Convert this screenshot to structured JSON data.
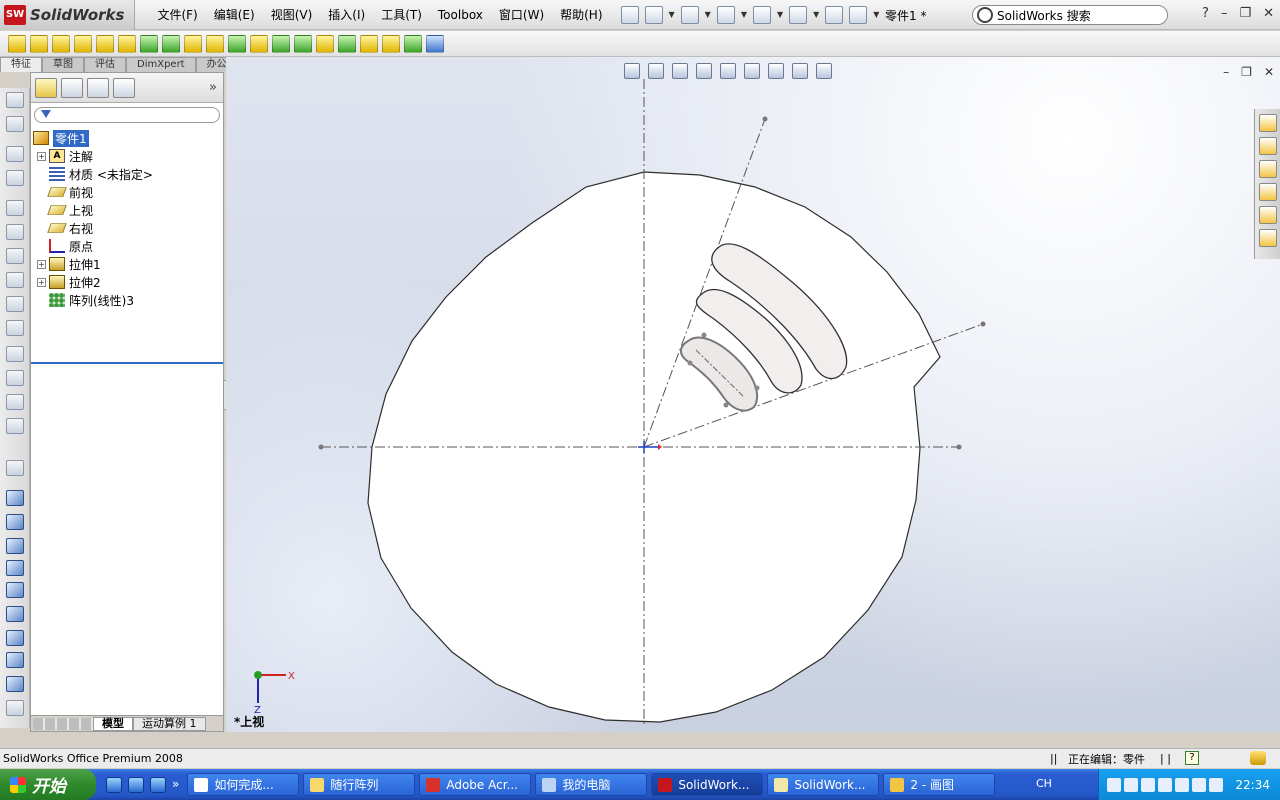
{
  "app": {
    "logo_text": "SolidWorks",
    "document_title": "零件1 *",
    "search_placeholder": "SolidWorks 搜索"
  },
  "menu": [
    "文件(F)",
    "编辑(E)",
    "视图(V)",
    "插入(I)",
    "工具(T)",
    "Toolbox",
    "窗口(W)",
    "帮助(H)"
  ],
  "command_tabs": [
    "特征",
    "草图",
    "评估",
    "DimXpert",
    "办公室产品"
  ],
  "feature_tree": {
    "root": "零件1",
    "items": [
      {
        "label": "注解",
        "expandable": true,
        "icon": "annotation-icon"
      },
      {
        "label": "材质 <未指定>",
        "expandable": false,
        "icon": "material-icon"
      },
      {
        "label": "前视",
        "expandable": false,
        "icon": "plane-icon"
      },
      {
        "label": "上视",
        "expandable": false,
        "icon": "plane-icon"
      },
      {
        "label": "右视",
        "expandable": false,
        "icon": "plane-icon"
      },
      {
        "label": "原点",
        "expandable": false,
        "icon": "origin-icon"
      },
      {
        "label": "拉伸1",
        "expandable": true,
        "icon": "extrude-icon"
      },
      {
        "label": "拉伸2",
        "expandable": true,
        "icon": "extrude-icon"
      },
      {
        "label": "阵列(线性)3",
        "expandable": false,
        "icon": "pattern-icon"
      }
    ]
  },
  "panel_bottom_tabs": [
    "模型",
    "运动算例 1"
  ],
  "graphics": {
    "view_label": "*上视",
    "triad_x": "X",
    "triad_z": "Z"
  },
  "statusbar": {
    "product": "SolidWorks Office Premium 2008",
    "editing": "正在编辑：零件"
  },
  "taskbar": {
    "start": "开始",
    "tasks": [
      "如何完成...",
      "随行阵列",
      "Adobe Acr...",
      "我的电脑",
      "SolidWork...",
      "SolidWork...",
      "2 - 画图"
    ],
    "language": "CH",
    "clock": "22:34"
  }
}
